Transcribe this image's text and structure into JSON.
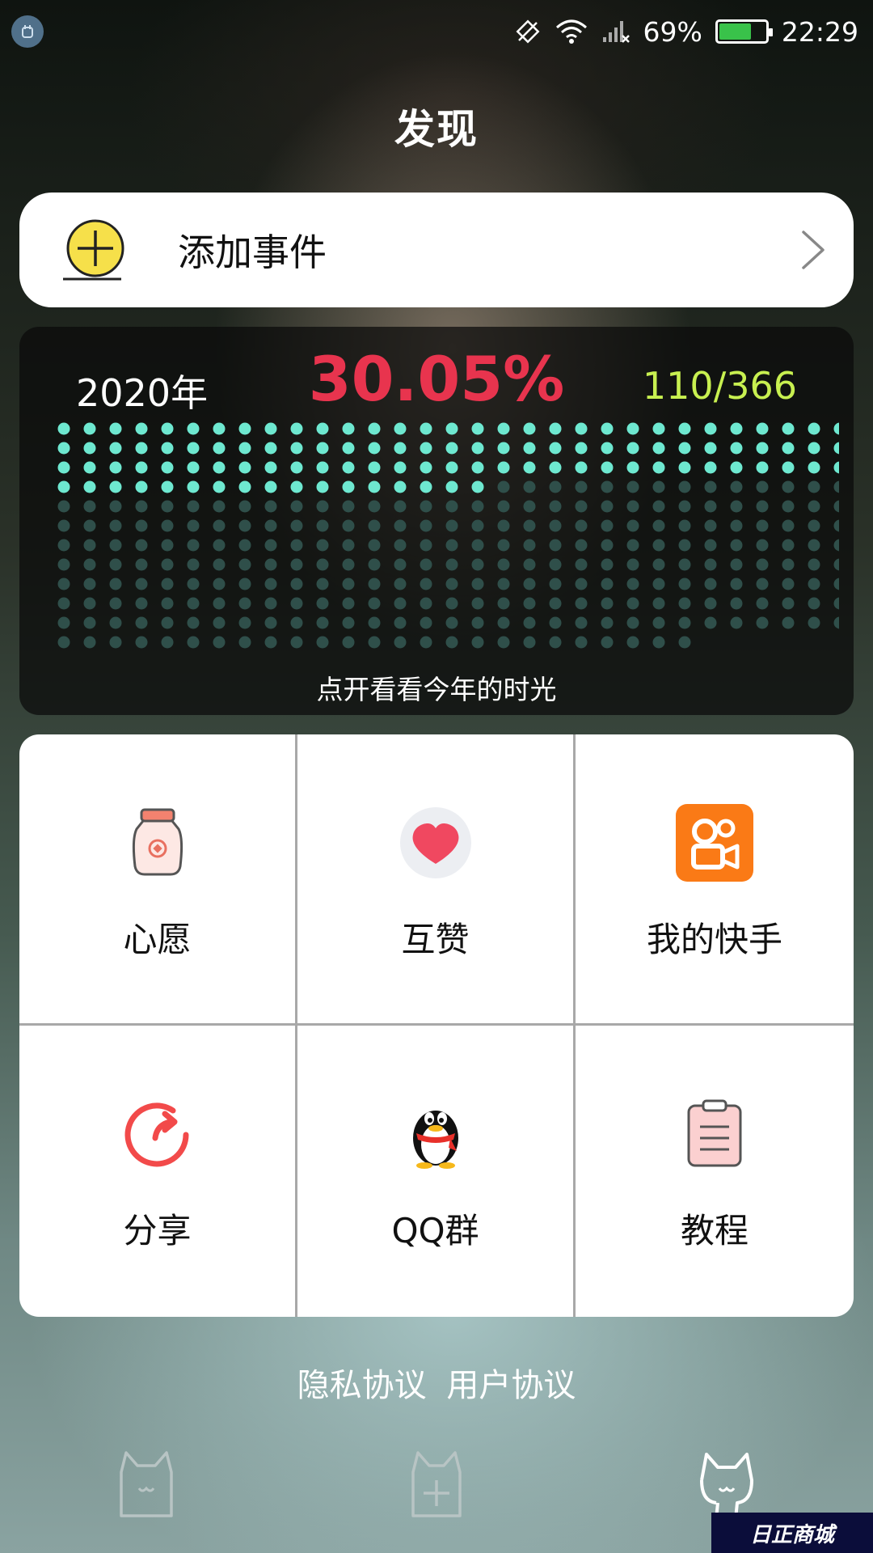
{
  "status_bar": {
    "battery_percent": "69%",
    "battery_level": 0.69,
    "time": "22:29",
    "icons": [
      "notification-icon",
      "rotate-icon",
      "wifi-icon",
      "signal-icon",
      "battery-icon"
    ]
  },
  "page": {
    "title": "发现"
  },
  "add_event": {
    "label": "添加事件",
    "icon": "add-circle-icon"
  },
  "year_progress": {
    "year": "2020年",
    "percent": "30.05%",
    "days": "110/366",
    "days_passed": 110,
    "days_total": 366,
    "caption": "点开看看今年的时光",
    "colors": {
      "percent": "#e8344e",
      "days": "#c8f050",
      "dot_active": "#6ee8d0",
      "dot_inactive": "#2f4f4a"
    }
  },
  "grid": {
    "items": [
      {
        "label": "心愿",
        "icon": "wish-jar-icon"
      },
      {
        "label": "互赞",
        "icon": "heart-icon"
      },
      {
        "label": "我的快手",
        "icon": "kuaishou-icon"
      },
      {
        "label": "分享",
        "icon": "share-icon"
      },
      {
        "label": "QQ群",
        "icon": "qq-penguin-icon"
      },
      {
        "label": "教程",
        "icon": "clipboard-icon"
      }
    ]
  },
  "footer": {
    "privacy": "隐私协议",
    "user_agreement": "用户协议"
  },
  "bottom_nav": {
    "items": [
      {
        "icon": "cat-home-icon",
        "active": false
      },
      {
        "icon": "cat-add-icon",
        "active": false
      },
      {
        "icon": "cat-discover-icon",
        "active": true
      }
    ]
  },
  "watermark": {
    "text": "日正商城"
  }
}
